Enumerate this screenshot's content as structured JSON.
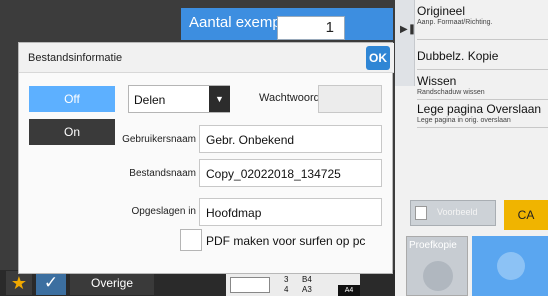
{
  "copies": {
    "label": "Aantal exempl.",
    "value": "1"
  },
  "right_panel": {
    "items": [
      {
        "title": "Origineel",
        "subtitle": "Aanp. Formaat/Richting."
      },
      {
        "title": "Dubbelz. Kopie",
        "subtitle": ""
      },
      {
        "title": "Wissen",
        "subtitle": "Randschaduw wissen"
      },
      {
        "title": "Lege pagina Overslaan",
        "subtitle": "Lege pagina in orig. overslaan"
      }
    ],
    "preview_label": "Voorbeeld",
    "ca_label": "CA",
    "proefkopie_label": "Proefkopie"
  },
  "bottom": {
    "overige_label": "Overige",
    "tray_3": "3",
    "tray_4": "4",
    "size_b4": "B4",
    "size_a3": "A3",
    "size_a4": "A4"
  },
  "dialog": {
    "title": "Bestandsinformatie",
    "ok_label": "OK",
    "off_label": "Off",
    "on_label": "On",
    "select_value": "Delen",
    "password_label": "Wachtwoord",
    "fields": [
      {
        "label": "Gebruikersnaam",
        "value": "Gebr. Onbekend"
      },
      {
        "label": "Bestandsnaam",
        "value": "Copy_02022018_134725"
      },
      {
        "label": "Opgeslagen in",
        "value": "Hoofdmap"
      }
    ],
    "checkbox_label": "PDF maken voor surfen op pc"
  },
  "colors": {
    "accent": "#2f86d5",
    "off_selected": "#5db0ff",
    "ca": "#f0b400"
  }
}
